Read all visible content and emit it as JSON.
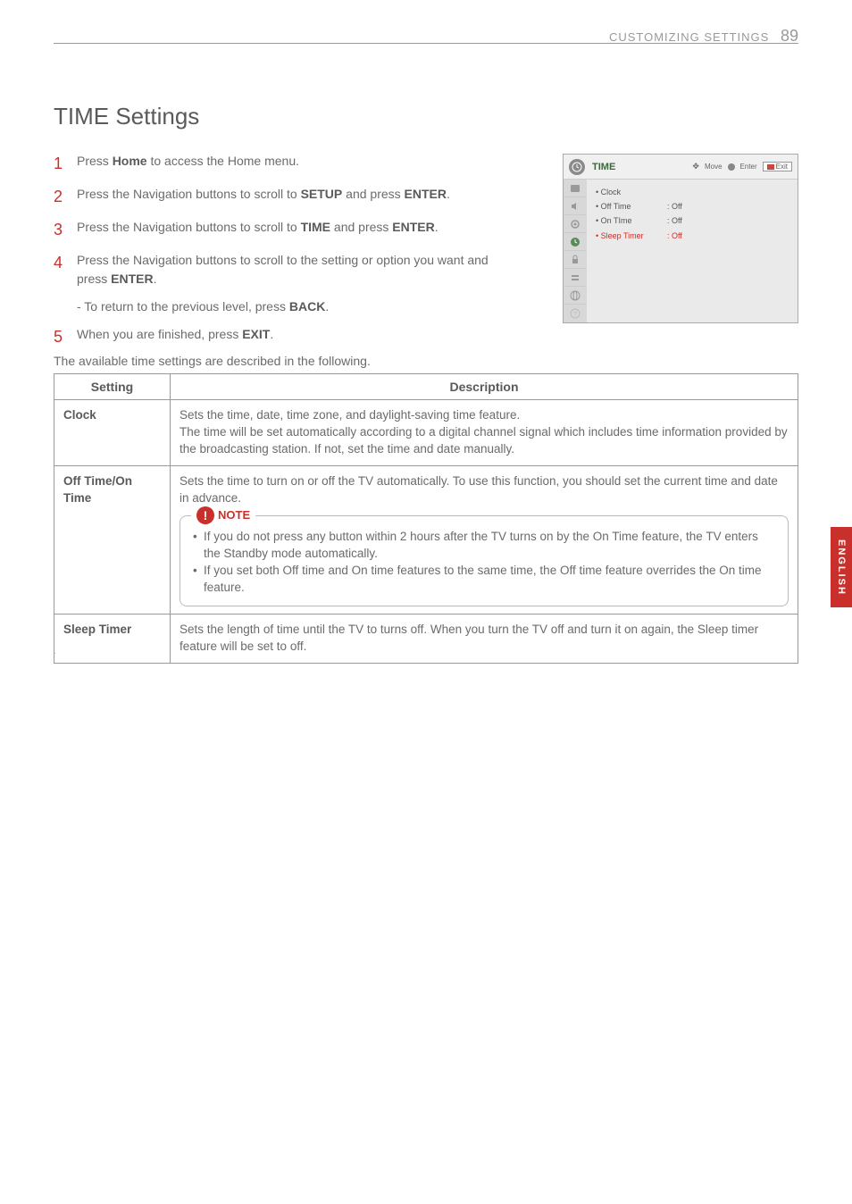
{
  "header": {
    "section": "CUSTOMIZING SETTINGS",
    "page": "89"
  },
  "title": "TIME Settings",
  "steps": {
    "s1": {
      "num": "1",
      "pre": "Press ",
      "b1": "Home",
      "post": " to access the Home menu."
    },
    "s2": {
      "num": "2",
      "pre": "Press the Navigation buttons to scroll to ",
      "b1": "SETUP",
      "mid": " and press ",
      "b2": "ENTER",
      "post": "."
    },
    "s3": {
      "num": "3",
      "pre": "Press the Navigation buttons to scroll to ",
      "b1": "TIME",
      "mid": " and press ",
      "b2": "ENTER",
      "post": "."
    },
    "s4": {
      "num": "4",
      "pre": "Press the Navigation buttons to scroll to the setting or option you want and press ",
      "b1": "ENTER",
      "post": "."
    },
    "s4sub": {
      "pre": "- To return to the previous level, press ",
      "b1": "BACK",
      "post": "."
    },
    "s5": {
      "num": "5",
      "pre": "When you are finished, press ",
      "b1": "EXIT",
      "post": "."
    }
  },
  "osd": {
    "title": "TIME",
    "move": "Move",
    "enter": "Enter",
    "exit": "Exit",
    "items": {
      "clock": {
        "label": "Clock",
        "value": ""
      },
      "off_time": {
        "label": "Off Time",
        "value": "Off"
      },
      "on_time": {
        "label": "On TIme",
        "value": "Off"
      },
      "sleep": {
        "label": "Sleep Timer",
        "value": "Off"
      }
    }
  },
  "intro": "The available time settings are described in the following.",
  "table": {
    "head_setting": "Setting",
    "head_desc": "Description",
    "clock": {
      "name": "Clock",
      "desc": "Sets the time, date, time zone, and daylight-saving time feature.\nThe time will be set automatically according to a digital channel signal which includes time information provided by the broadcasting station. If not, set the time and date manually."
    },
    "offon": {
      "name": "Off Time/On Time",
      "desc": "Sets the time to turn on or off the TV automatically. To use this function, you should set the current time and date in advance.",
      "note_label": "NOTE",
      "note1": "If you do not press any button within 2 hours after the TV turns on by the On Time feature, the TV enters the Standby mode automatically.",
      "note2": "If you set both Off time and On time features to the same time, the Off time feature overrides the On time feature."
    },
    "sleep": {
      "name": "Sleep Timer",
      "desc": "Sets the length of time until the TV to turns off. When you turn the TV off and turn it on again, the Sleep timer feature will be set to off."
    }
  },
  "side_tab": "ENGLISH"
}
